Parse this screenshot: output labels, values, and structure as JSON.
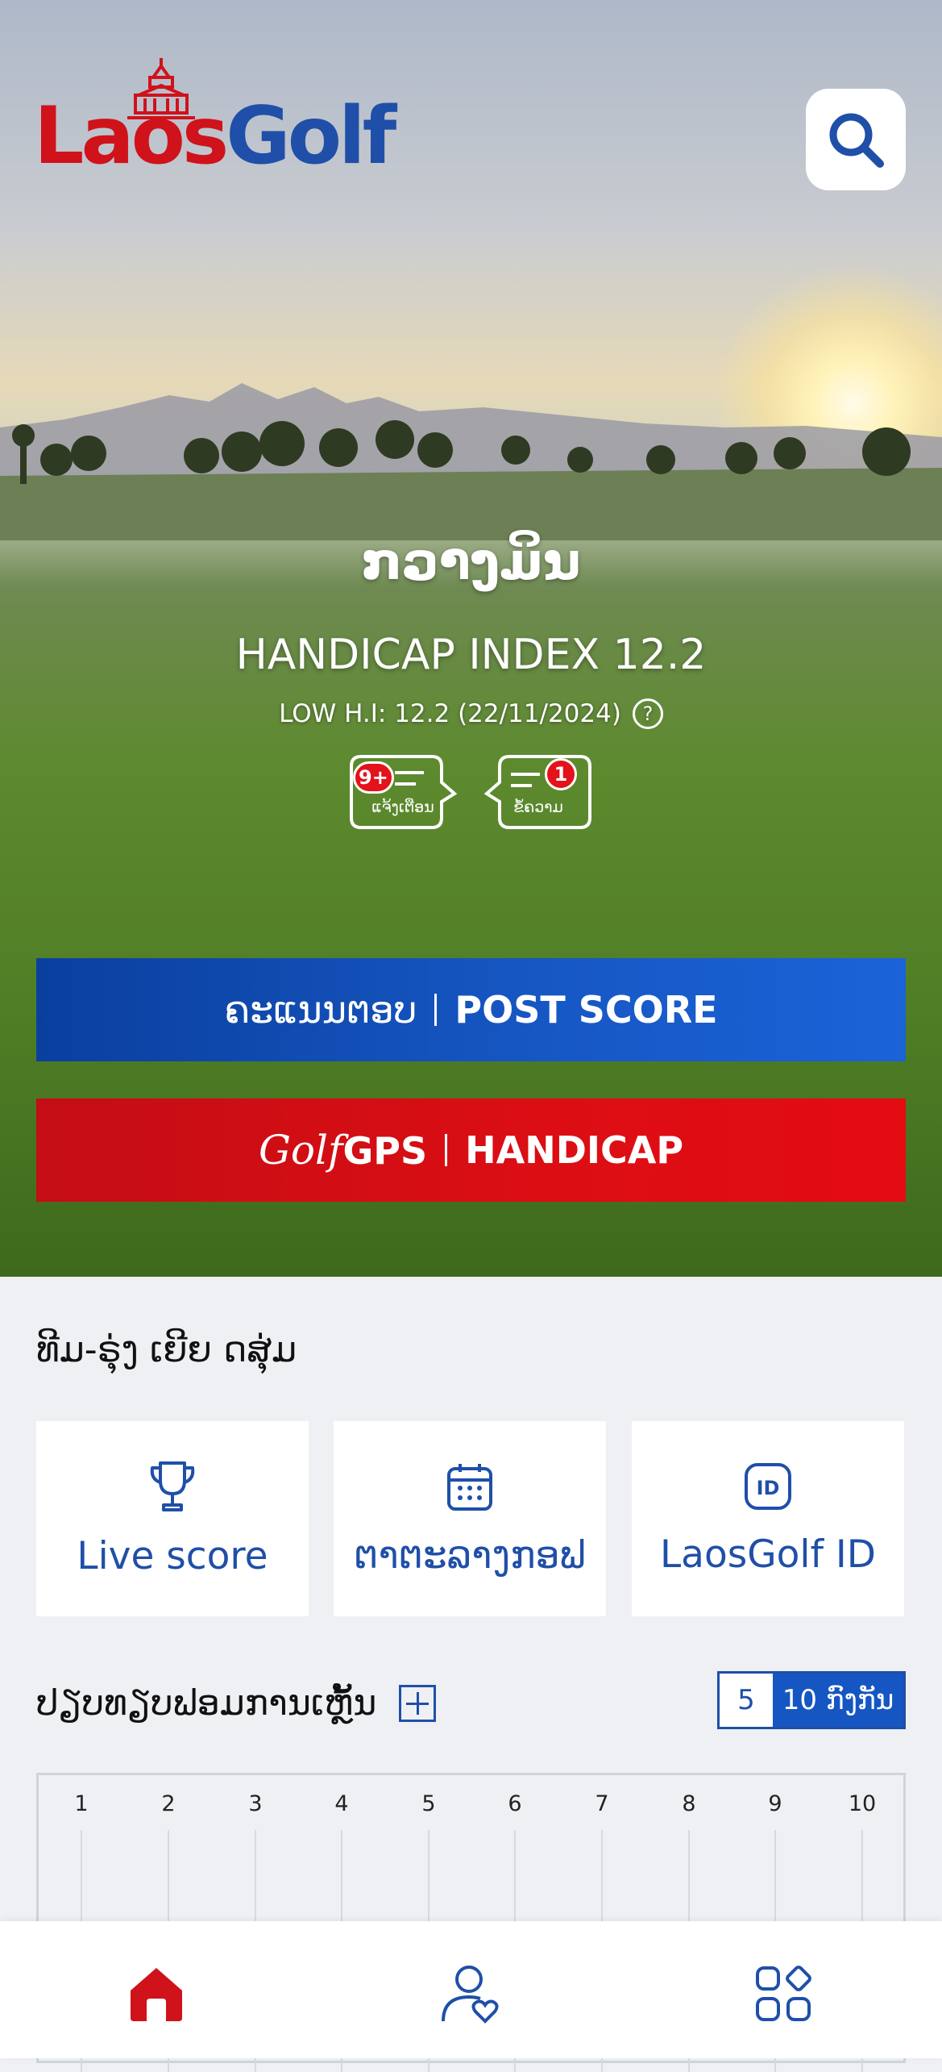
{
  "header": {
    "logo_laos": "Laos",
    "logo_golf": "Golf"
  },
  "profile": {
    "name": "ກວາງມິນ",
    "handicap_index": "HANDICAP INDEX 12.2",
    "low_hi": "LOW H.I: 12.2 (22/11/2024)",
    "notifications": {
      "label": "ແຈ້ງເຕືອນ",
      "badge": "9+"
    },
    "messages": {
      "label": "ຂໍ້ຄວາມ",
      "badge": "1"
    }
  },
  "actions": {
    "post_score_lao": "ຄະແນນຕອບ",
    "post_score_en": "POST SCORE",
    "gps_script": "Golf",
    "gps_label": "GPS",
    "handicap_label": "HANDICAP"
  },
  "team": {
    "title": "ທີມ-ຣຸ່ງ ເຍີຍ ດສຸ່ມ",
    "cards": [
      {
        "label": "Live score",
        "icon": "trophy-icon"
      },
      {
        "label": "ຕາຕະລາງກອຟ",
        "icon": "calendar-icon"
      },
      {
        "label": "LaosGolf ID",
        "icon": "id-icon"
      }
    ]
  },
  "performance": {
    "title": "ປຽບທຽບຟອມການເຫຼັ້ນ",
    "toggle_5": "5",
    "toggle_10": "10 ກົງກັນ",
    "columns": [
      "1",
      "2",
      "3",
      "4",
      "5",
      "6",
      "7",
      "8",
      "9",
      "10"
    ]
  },
  "nav": {
    "items": [
      "home-icon",
      "profile-heart-icon",
      "apps-grid-icon"
    ]
  },
  "colors": {
    "brand_blue": "#1f4fa8",
    "brand_red": "#d0121b",
    "post_button": "#1656c2",
    "gps_button": "#dc0e14"
  }
}
